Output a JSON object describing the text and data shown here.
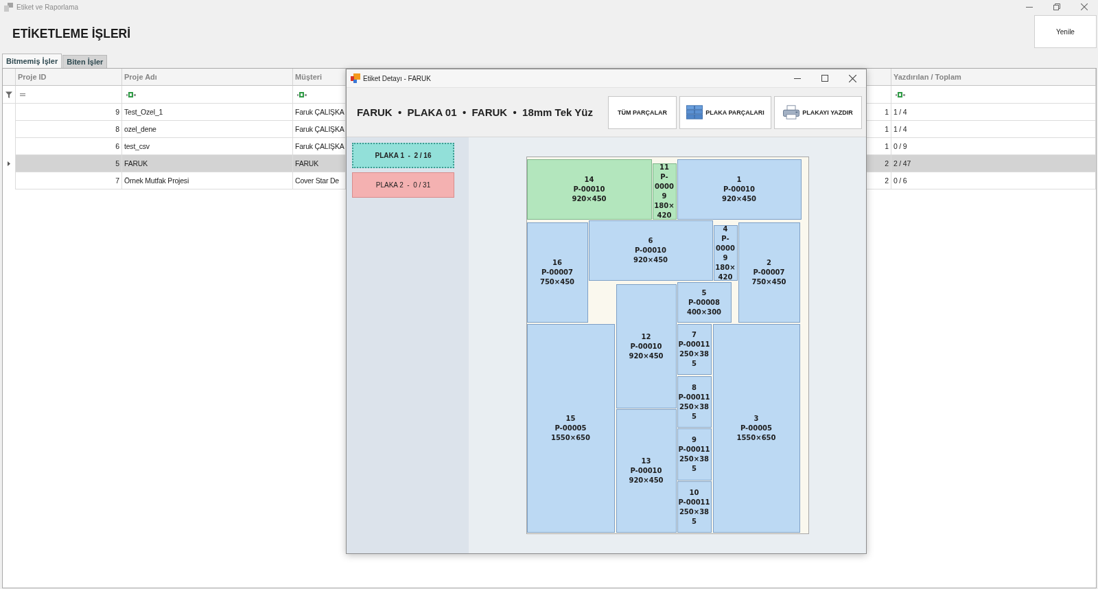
{
  "window": {
    "title": "Etiket ve Raporlama"
  },
  "header": {
    "title": "ETİKETLEME İŞLERİ",
    "refresh_button": "Yenile"
  },
  "tabs": [
    {
      "label": "Bitmemiş İşler",
      "selected": true
    },
    {
      "label": "Biten İşler",
      "selected": false
    }
  ],
  "grid": {
    "columns": [
      {
        "label": "Proje ID",
        "kind": "number",
        "filter": {
          "kind": "equals"
        }
      },
      {
        "label": "Proje Adı",
        "kind": "text",
        "filter": {
          "kind": "contains"
        }
      },
      {
        "label": "Müşteri",
        "kind": "text",
        "filter": {
          "kind": "contains"
        }
      },
      {
        "kind": "number"
      },
      {
        "label": "Yazdırılan / Toplam",
        "kind": "text",
        "filter": {
          "kind": "contains"
        }
      }
    ],
    "rows": [
      {
        "cells": [
          "9",
          "Test_Ozel_1",
          "Faruk ÇALIŞKA",
          "1",
          "1 / 4"
        ],
        "selected": false
      },
      {
        "cells": [
          "8",
          "ozel_dene",
          "Faruk ÇALIŞKA",
          "1",
          "1 / 4"
        ],
        "selected": false
      },
      {
        "cells": [
          "6",
          "test_csv",
          "Faruk ÇALIŞKA",
          "1",
          "0 / 9"
        ],
        "selected": false
      },
      {
        "cells": [
          "5",
          "FARUK",
          "FARUK",
          "2",
          "2 / 47"
        ],
        "selected": true
      },
      {
        "cells": [
          "7",
          "Örnek Mutfak Projesi",
          "Cover Star De",
          "2",
          "0 / 6"
        ],
        "selected": false
      }
    ]
  },
  "dialog": {
    "title": "Etiket Detayı - FARUK",
    "heading": "FARUK  •  PLAKA 01  •  FARUK  •  18mm Tek Yüz",
    "buttons": [
      {
        "label": "TÜM PARÇALAR",
        "kind": "plain"
      },
      {
        "label": "PLAKA PARÇALARI",
        "kind": "parts"
      },
      {
        "label": "PLAKAYI YAZDIR",
        "kind": "print"
      }
    ],
    "sheets": [
      {
        "label": "PLAKA 1  -  2 / 16",
        "selected": true
      },
      {
        "label": "PLAKA 2  -  0 / 31",
        "selected": false
      }
    ],
    "parts": [
      {
        "number": "14",
        "code": "P-00010",
        "size": "920×450",
        "printed": true
      },
      {
        "number": "11",
        "code": "P-00009",
        "size": "180×420",
        "printed": true
      },
      {
        "number": "1",
        "code": "P-00010",
        "size": "920×450",
        "printed": false
      },
      {
        "number": "16",
        "code": "P-00007",
        "size": "750×450",
        "printed": false
      },
      {
        "number": "6",
        "code": "P-00010",
        "size": "920×450",
        "printed": false
      },
      {
        "number": "4",
        "code": "P-00009",
        "size": "180×420",
        "printed": false
      },
      {
        "number": "2",
        "code": "P-00007",
        "size": "750×450",
        "printed": false
      },
      {
        "number": "12",
        "code": "P-00010",
        "size": "920×450",
        "printed": false
      },
      {
        "number": "5",
        "code": "P-00008",
        "size": "400×300",
        "printed": false
      },
      {
        "number": "15",
        "code": "P-00005",
        "size": "1550×650",
        "printed": false
      },
      {
        "number": "13",
        "code": "P-00010",
        "size": "920×450",
        "printed": false
      },
      {
        "number": "7",
        "code": "P-00011",
        "size": "250×385",
        "printed": false
      },
      {
        "number": "8",
        "code": "P-00011",
        "size": "250×385",
        "printed": false
      },
      {
        "number": "9",
        "code": "P-00011",
        "size": "250×385",
        "printed": false
      },
      {
        "number": "10",
        "code": "P-00011",
        "size": "250×385",
        "printed": false
      },
      {
        "number": "3",
        "code": "P-00005",
        "size": "1550×650",
        "printed": false
      }
    ]
  }
}
